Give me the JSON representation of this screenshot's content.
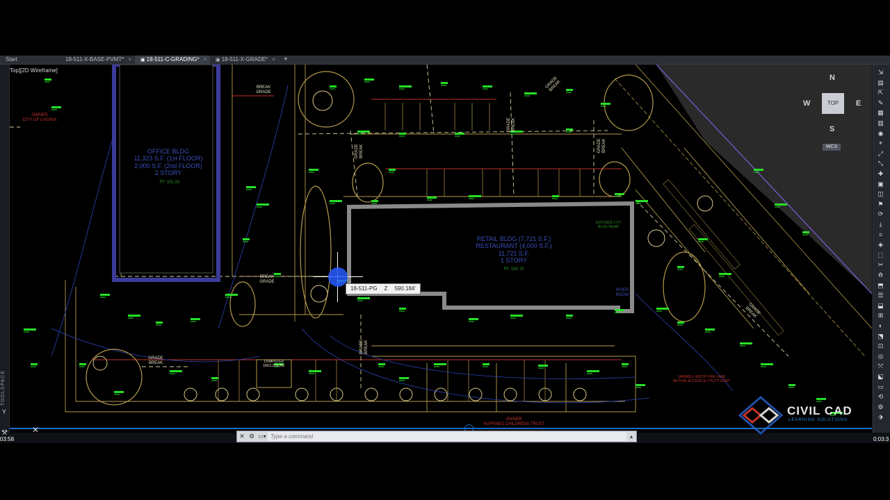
{
  "tabs": [
    {
      "label": "Start",
      "active": false
    },
    {
      "label": "18-511-X-BASE-PVMT*",
      "active": false
    },
    {
      "label": "18-511-C-GRADING*",
      "active": true
    },
    {
      "label": "18-511-X-GRADE*",
      "active": false
    }
  ],
  "tab_close_glyph": "×",
  "viewport_label": "Top][2D Wireframe]",
  "palette": {
    "label": "TOOLSPACE"
  },
  "compass": {
    "n": "N",
    "s": "S",
    "e": "E",
    "w": "W",
    "top": "TOP",
    "wcs": "WCS"
  },
  "drawing": {
    "office_bldg": "OFFICE BLDG\n11,323 S.F. (1st FLOOR)\n2,000 S.F. (2nd FLOOR)\n2 STORY",
    "office_ff": "FF: 591.55",
    "retail_bldg": "RETAIL BLDG (7,721 S.F.)\nRESTAURANT (4,000 S.F.)\n11,721 S.F.\n1 STORY",
    "retail_ff": "FF: 590.70",
    "owner_city": "OWNER\nCITY OF LIVONIA",
    "owner_trust": "OWNER\nHUFFINES CHILDRENS TRUST",
    "grade_break_labels": [
      "BREAK\nGRADE",
      "GRADE\nBREAK",
      "GRADE\nBREAK",
      "GRADE\nBREAK",
      "GRADE\nBREAK",
      "BREAK\nGRADE",
      "GRADE\nBREAK",
      "GRADE\nBREAK",
      "GRADE\nBREAK"
    ],
    "dumpster": "DUMPSTER\nENCLOSURE",
    "riser_room": "RISER\nROOM",
    "exposed_bldg": "EXPOSED 1 FT\nBLDG BEAM",
    "variable_width": "VARIABLE WIDTH FIRE LANE\nMUTUAL ACCESS & UTILITY ESMT"
  },
  "tooltip": {
    "point": "18-511-PG",
    "axis": "Z",
    "value": "590.184'"
  },
  "command": {
    "placeholder": "Type a command"
  },
  "timestamps": {
    "elapsed": "03:58",
    "total": "0:03:3"
  },
  "watermark": {
    "title": "CIVIL CAD",
    "subtitle": "LEARNING SOLUTIONS"
  },
  "colors": {
    "accent_blue": "#1a6fc9",
    "green_anno": "#27e027",
    "tan_lines": "#b69b4c",
    "building_fill": "#000000"
  }
}
